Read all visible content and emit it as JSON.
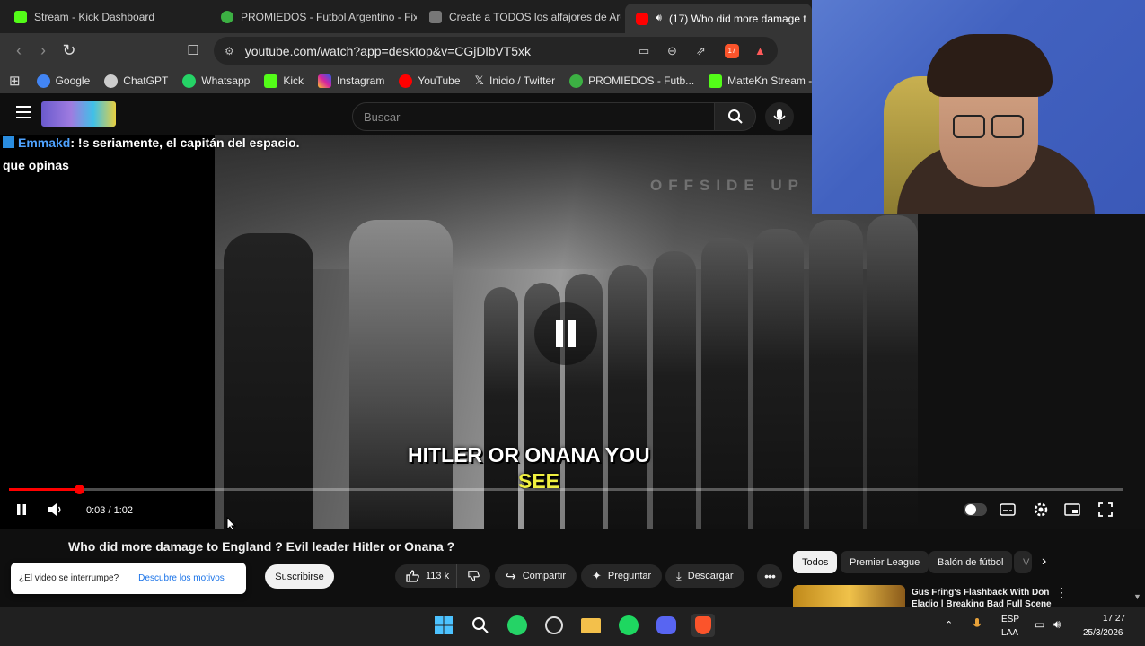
{
  "browser": {
    "tabs": [
      {
        "label": "Stream - Kick Dashboard",
        "color": "#53fc18"
      },
      {
        "label": "PROMIEDOS - Futbol Argentino - Fixt",
        "color": "#3cb043"
      },
      {
        "label": "Create a TODOS los alfajores de Arge",
        "color": "#777777"
      },
      {
        "label": "(17) Who did more damage t",
        "color": "#ff0000",
        "active": true
      }
    ],
    "url": "youtube.com/watch?app=desktop&v=CGjDlbVT5xk",
    "shield_count": "17",
    "bookmarks": [
      {
        "label": "Google",
        "color": "#4285f4"
      },
      {
        "label": "ChatGPT",
        "color": "#cccccc"
      },
      {
        "label": "Whatsapp",
        "color": "#25d366"
      },
      {
        "label": "Kick",
        "color": "#53fc18"
      },
      {
        "label": "Instagram",
        "color": "#d6249f"
      },
      {
        "label": "YouTube",
        "color": "#ff0000"
      },
      {
        "label": "Inicio / Twitter",
        "color": "#e0e0e0"
      },
      {
        "label": "PROMIEDOS - Futb...",
        "color": "#3cb043"
      },
      {
        "label": "MatteKn Stream -...",
        "color": "#53fc18"
      }
    ]
  },
  "youtube": {
    "search_placeholder": "Buscar",
    "chat": {
      "user": "Emmakd",
      "message": ": !s seriamente, el capitán del espacio.",
      "line2": "que opinas"
    },
    "video": {
      "watermark": "OFFSIDE UP",
      "caption_line1": "HITLER OR ONANA YOU",
      "caption_line2": "SEE",
      "time": "0:03 / 1:02",
      "progress": 0.063,
      "title": "Who did more damage to England ? Evil leader Hitler or Onana ?"
    },
    "subscribe": "Suscribirse",
    "likes": "113 k",
    "share": "Compartir",
    "ask": "Preguntar",
    "download": "Descargar",
    "toast": {
      "text": "¿El video se interrumpe?",
      "link": "Descubre los motivos"
    },
    "chips": [
      "Todos",
      "Premier League",
      "Balón de fútbol",
      "V"
    ],
    "recommendation": {
      "title": "Gus Fring's Flashback With Don Eladio | Breaking Bad Full Scene"
    }
  },
  "taskbar": {
    "lang1": "ESP",
    "lang2": "LAA",
    "time": "17:27",
    "date": "25/3/2026"
  }
}
